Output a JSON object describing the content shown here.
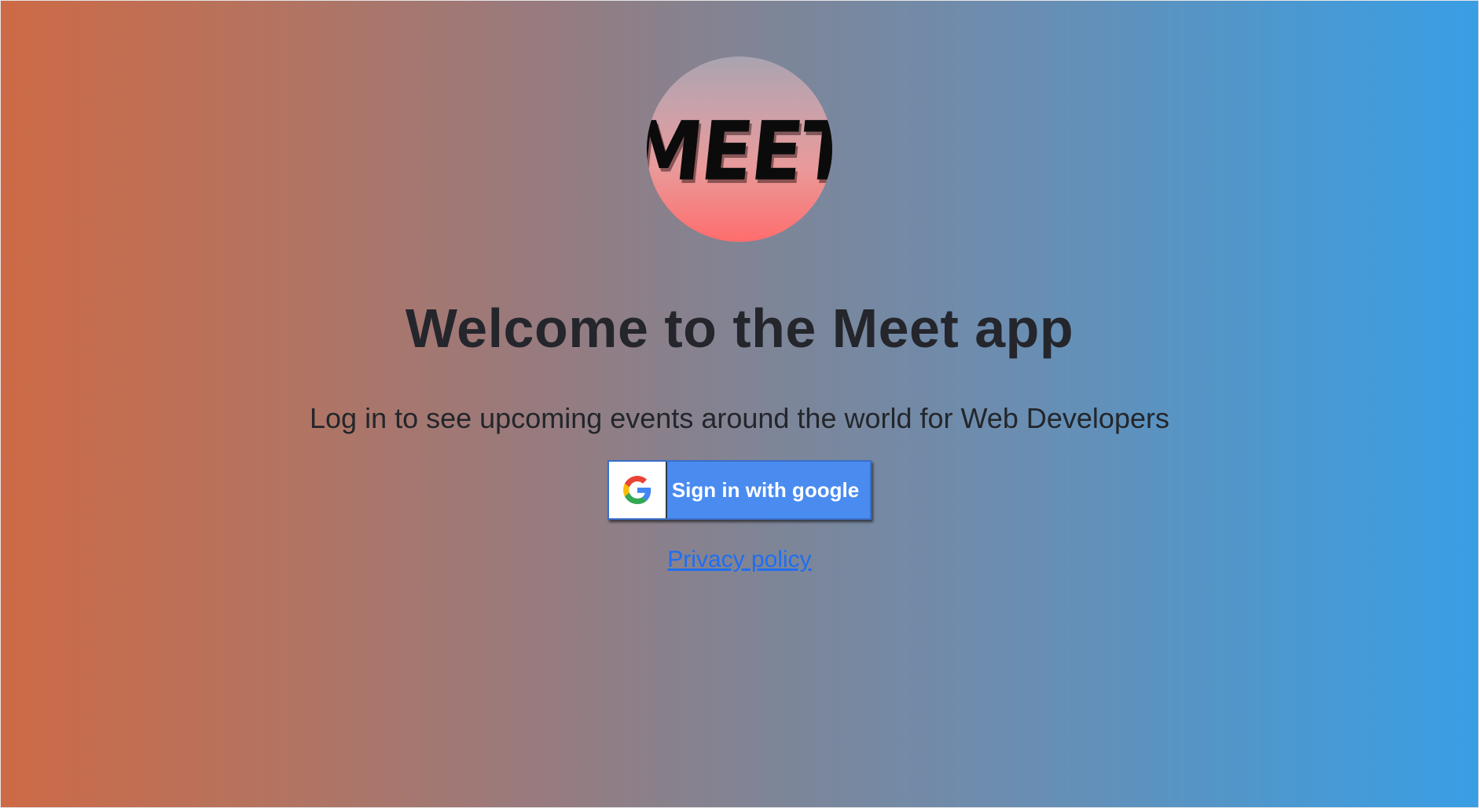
{
  "logo": {
    "text": "MEET"
  },
  "main": {
    "title": "Welcome to the Meet app",
    "subtitle": "Log in to see upcoming events around the world for Web Developers"
  },
  "signin": {
    "label": "Sign in with google",
    "icon": "google-g-icon"
  },
  "footer": {
    "privacy_label": "Privacy policy"
  },
  "colors": {
    "gradient_left": "#cd6a46",
    "gradient_right": "#3a9ee5",
    "button_bg": "#4a8bf0",
    "link": "#1f6ef0",
    "text": "#24262c"
  }
}
